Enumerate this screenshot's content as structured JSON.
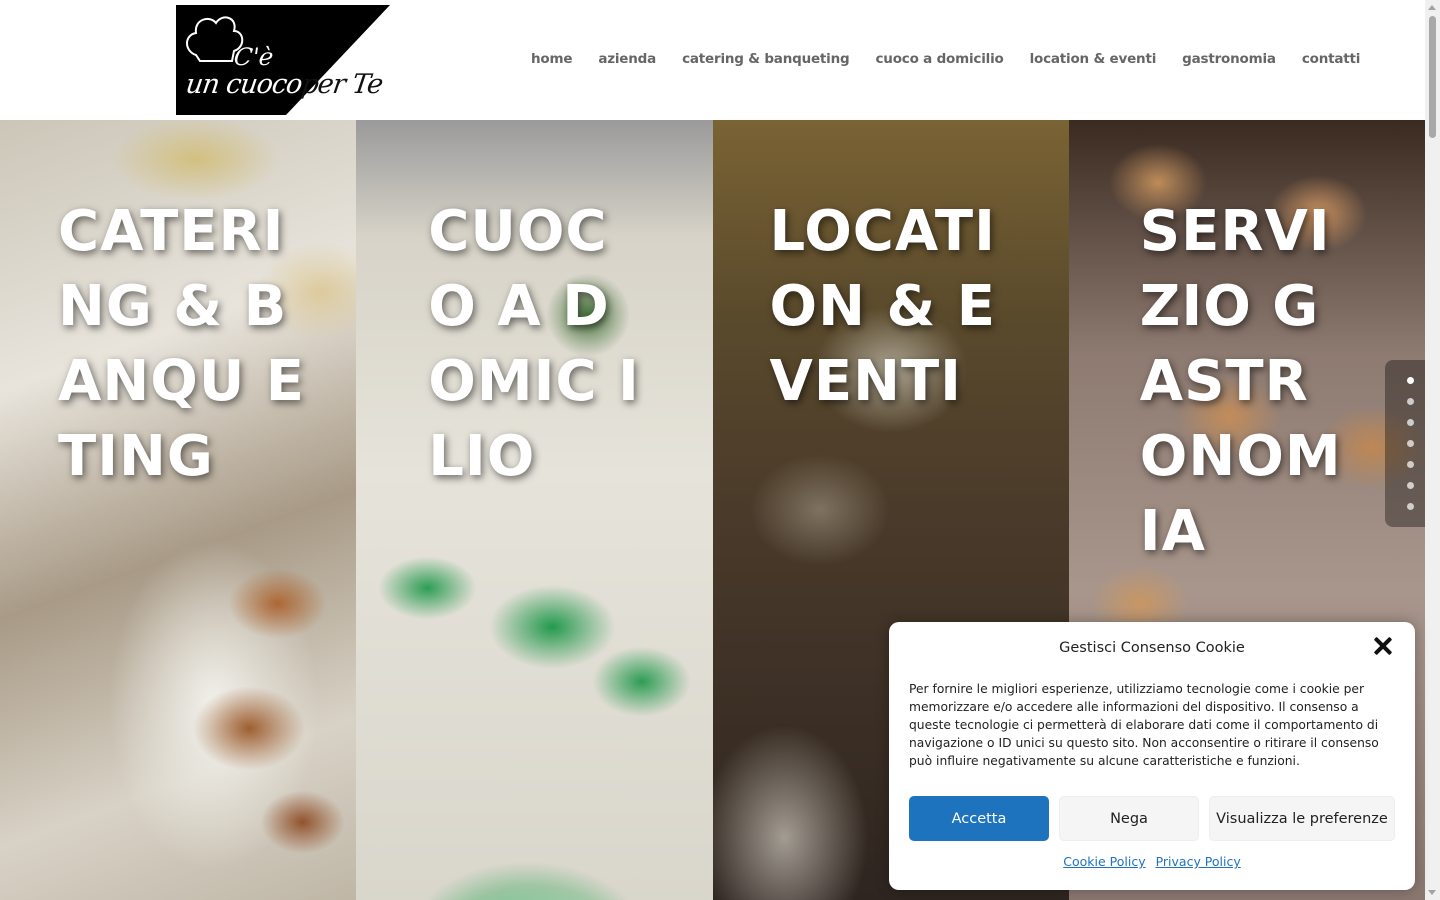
{
  "header": {
    "logo": {
      "line1": "C'è",
      "line2_part1": "un cuoco",
      "line2_part2": "per Te"
    },
    "nav": [
      {
        "label": "home"
      },
      {
        "label": "azienda"
      },
      {
        "label": "catering & banqueting"
      },
      {
        "label": "cuoco a domicilio"
      },
      {
        "label": "location & eventi"
      },
      {
        "label": "gastronomia"
      },
      {
        "label": "contatti"
      }
    ]
  },
  "panels": [
    {
      "title": "CATERI NG & BANQU ETING"
    },
    {
      "title": "CUOC O A DOMIC ILIO"
    },
    {
      "title": "LOCATI ON & EVENTI"
    },
    {
      "title": "SERVI ZIO GASTR ONOM IA"
    }
  ],
  "side_nav": {
    "count": 7,
    "active_index": 0
  },
  "cookie": {
    "title": "Gestisci Consenso Cookie",
    "text": "Per fornire le migliori esperienze, utilizziamo tecnologie come i cookie per memorizzare e/o accedere alle informazioni del dispositivo. Il consenso a queste tecnologie ci permetterà di elaborare dati come il comportamento di navigazione o ID unici su questo sito. Non acconsentire o ritirare il consenso può influire negativamente su alcune caratteristiche e funzioni.",
    "accept": "Accetta",
    "deny": "Nega",
    "preferences": "Visualizza le preferenze",
    "cookie_policy": "Cookie Policy",
    "privacy_policy": "Privacy Policy"
  },
  "colors": {
    "accent": "#1e73be",
    "nav_text": "#666666",
    "logo_bg": "#000000"
  }
}
